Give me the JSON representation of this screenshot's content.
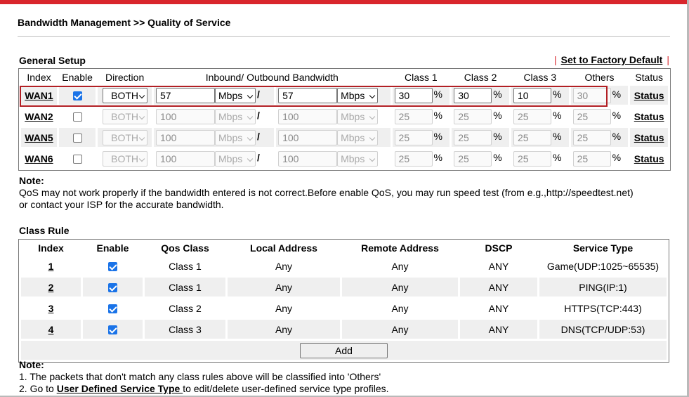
{
  "page": {
    "title": "Bandwidth Management >> Quality of Service"
  },
  "general": {
    "title": "General Setup",
    "factory_default": "Set to Factory Default",
    "headers": {
      "index": "Index",
      "enable": "Enable",
      "direction": "Direction",
      "bandwidth": "Inbound/ Outbound Bandwidth",
      "class1": "Class 1",
      "class2": "Class 2",
      "class3": "Class 3",
      "others": "Others",
      "status": "Status"
    },
    "rows": [
      {
        "name": "WAN1",
        "enabled": true,
        "direction": "BOTH",
        "inbound": "57",
        "in_unit": "Mbps",
        "outbound": "57",
        "out_unit": "Mbps",
        "c1": "30",
        "c2": "30",
        "c3": "10",
        "others": "30",
        "status": "Status"
      },
      {
        "name": "WAN2",
        "enabled": false,
        "direction": "BOTH",
        "inbound": "100",
        "in_unit": "Mbps",
        "outbound": "100",
        "out_unit": "Mbps",
        "c1": "25",
        "c2": "25",
        "c3": "25",
        "others": "25",
        "status": "Status"
      },
      {
        "name": "WAN5",
        "enabled": false,
        "direction": "BOTH",
        "inbound": "100",
        "in_unit": "Mbps",
        "outbound": "100",
        "out_unit": "Mbps",
        "c1": "25",
        "c2": "25",
        "c3": "25",
        "others": "25",
        "status": "Status"
      },
      {
        "name": "WAN6",
        "enabled": false,
        "direction": "BOTH",
        "inbound": "100",
        "in_unit": "Mbps",
        "outbound": "100",
        "out_unit": "Mbps",
        "c1": "25",
        "c2": "25",
        "c3": "25",
        "others": "25",
        "status": "Status"
      }
    ],
    "symbols": {
      "slash": "/",
      "percent": "%"
    }
  },
  "note1": {
    "title": "Note:",
    "line1": "QoS may not work properly if the bandwidth entered is not correct.Before enable QoS, you may run speed test (from e.g.,http://speedtest.net)",
    "line2": "or contact your ISP for the accurate bandwidth."
  },
  "class_rule": {
    "title": "Class Rule",
    "headers": {
      "index": "Index",
      "enable": "Enable",
      "qos_class": "Qos Class",
      "local": "Local Address",
      "remote": "Remote Address",
      "dscp": "DSCP",
      "service": "Service Type"
    },
    "rows": [
      {
        "index": "1",
        "enabled": true,
        "qos_class": "Class 1",
        "local": "Any",
        "remote": "Any",
        "dscp": "ANY",
        "service": "Game(UDP:1025~65535)"
      },
      {
        "index": "2",
        "enabled": true,
        "qos_class": "Class 1",
        "local": "Any",
        "remote": "Any",
        "dscp": "ANY",
        "service": "PING(IP:1)"
      },
      {
        "index": "3",
        "enabled": true,
        "qos_class": "Class 2",
        "local": "Any",
        "remote": "Any",
        "dscp": "ANY",
        "service": "HTTPS(TCP:443)"
      },
      {
        "index": "4",
        "enabled": true,
        "qos_class": "Class 3",
        "local": "Any",
        "remote": "Any",
        "dscp": "ANY",
        "service": "DNS(TCP/UDP:53)"
      }
    ],
    "add_label": "Add"
  },
  "note2": {
    "title": "Note:",
    "line1": "1. The packets that don't match any class rules above will be classified into 'Others'",
    "line2_prefix": "2. Go to ",
    "line2_link": "User Defined Service Type ",
    "line2_suffix": "to edit/delete user-defined service type profiles."
  },
  "colors": {
    "accent_red": "#d9262c",
    "checkbox_blue": "#1a73e8",
    "row_alt": "#efefef"
  }
}
